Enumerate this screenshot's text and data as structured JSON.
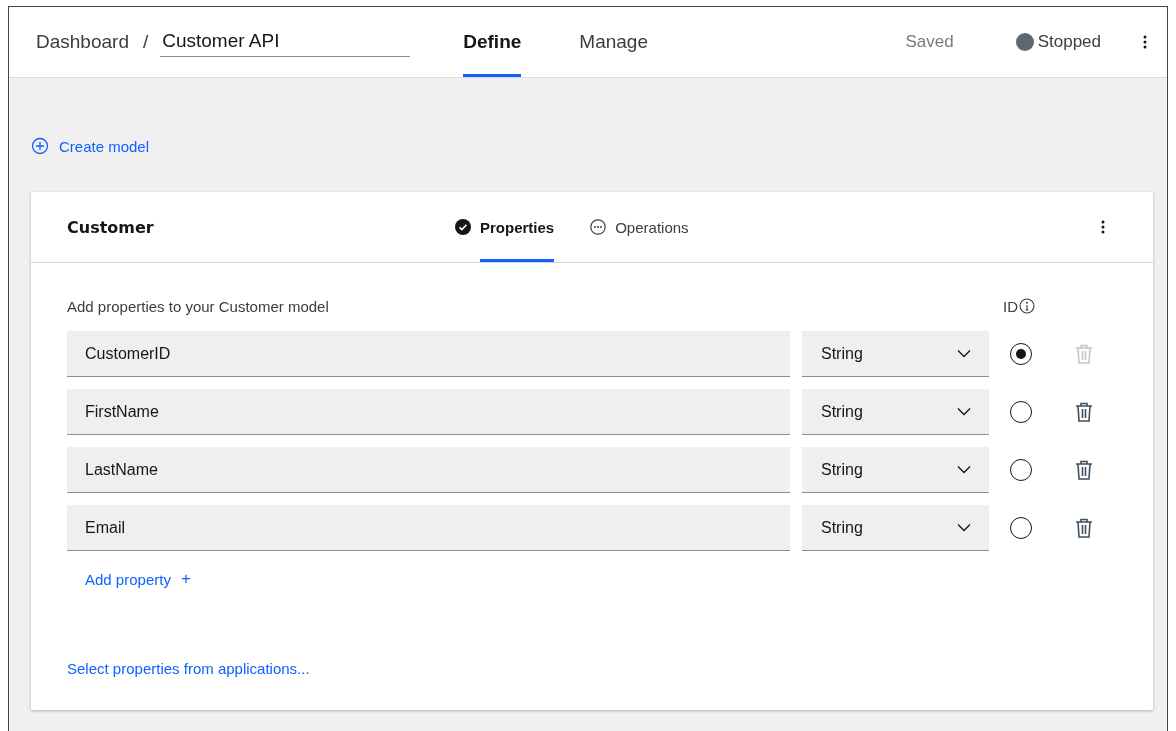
{
  "header": {
    "breadcrumb": "Dashboard",
    "separator": "/",
    "api_name": "Customer API",
    "tabs": [
      {
        "label": "Define",
        "selected": true
      },
      {
        "label": "Manage",
        "selected": false
      }
    ],
    "save_status": "Saved",
    "run_status": {
      "label": "Stopped",
      "color": "#5a6872"
    }
  },
  "create_model": {
    "label": "Create model"
  },
  "model": {
    "name": "Customer",
    "tabs": [
      {
        "label": "Properties",
        "selected": true,
        "kind": "check"
      },
      {
        "label": "Operations",
        "selected": false,
        "kind": "dots"
      }
    ],
    "intro": "Add properties to your Customer model",
    "id_heading": "ID",
    "properties": [
      {
        "name": "CustomerID",
        "type": "String",
        "selected": true,
        "delete_disabled": true
      },
      {
        "name": "FirstName",
        "type": "String",
        "selected": false,
        "delete_disabled": false
      },
      {
        "name": "LastName",
        "type": "String",
        "selected": false,
        "delete_disabled": false
      },
      {
        "name": "Email",
        "type": "String",
        "selected": false,
        "delete_disabled": false
      }
    ],
    "add_property": {
      "label": "Add property",
      "icon": "+"
    },
    "select_from_apps": "Select properties from applications..."
  }
}
